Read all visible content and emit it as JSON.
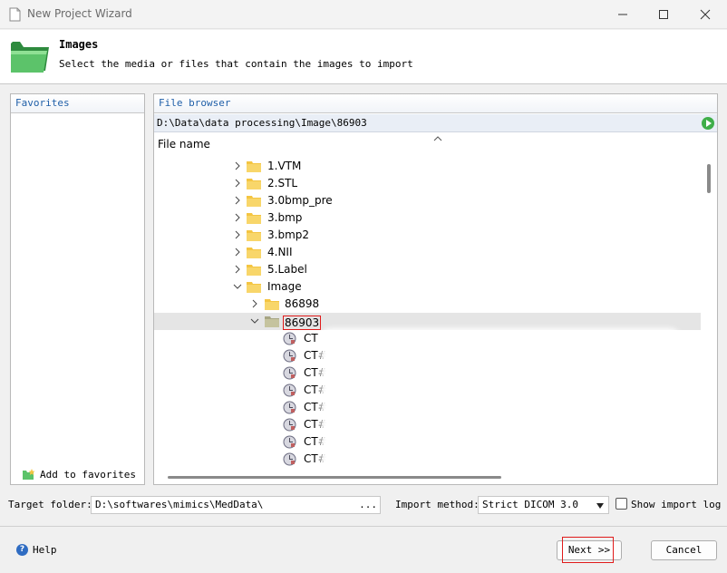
{
  "window": {
    "title": "New Project Wizard",
    "minimize_icon": "minimize-icon",
    "maximize_icon": "maximize-icon",
    "close_icon": "close-icon"
  },
  "header": {
    "title": "Images",
    "subtitle": "Select the media or files that contain the images to import",
    "icon": "folder-icon"
  },
  "favorites": {
    "title": "Favorites",
    "add_label": "Add to favorites"
  },
  "file_browser": {
    "title": "File browser",
    "path": "D:\\Data\\data processing\\Image\\86903",
    "column_header": "File name",
    "tree": [
      {
        "label": "1.VTM",
        "expanded": false
      },
      {
        "label": "2.STL",
        "expanded": false
      },
      {
        "label": "3.0bmp_pre",
        "expanded": false
      },
      {
        "label": "3.bmp",
        "expanded": false
      },
      {
        "label": "3.bmp2",
        "expanded": false
      },
      {
        "label": "4.NII",
        "expanded": false
      },
      {
        "label": "5.Label",
        "expanded": false
      },
      {
        "label": "Image",
        "expanded": true
      },
      {
        "label": "86898",
        "expanded": false
      },
      {
        "label": "86903",
        "expanded": true,
        "selected": true
      },
      {
        "label": "CT"
      },
      {
        "label": "CT#"
      },
      {
        "label": "CT#"
      },
      {
        "label": "CT#"
      },
      {
        "label": "CT#"
      },
      {
        "label": "CT#"
      },
      {
        "label": "CT#"
      },
      {
        "label": "CT#"
      }
    ]
  },
  "options": {
    "target_folder_label": "Target folder:",
    "target_folder_value": "D:\\softwares\\mimics\\MedData\\",
    "browse_label": "...",
    "import_method_label": "Import method:",
    "import_method_value": "Strict DICOM 3.0",
    "show_import_log_label": "Show import log",
    "show_import_log_checked": false
  },
  "footer": {
    "help_label": "Help",
    "next_label": "Next >>",
    "cancel_label": "Cancel"
  },
  "colors": {
    "accent": "#1f5fa8",
    "highlight_outline": "#e01b1b",
    "folder_yellow": "#f4c542",
    "go_green": "#3fae49"
  }
}
